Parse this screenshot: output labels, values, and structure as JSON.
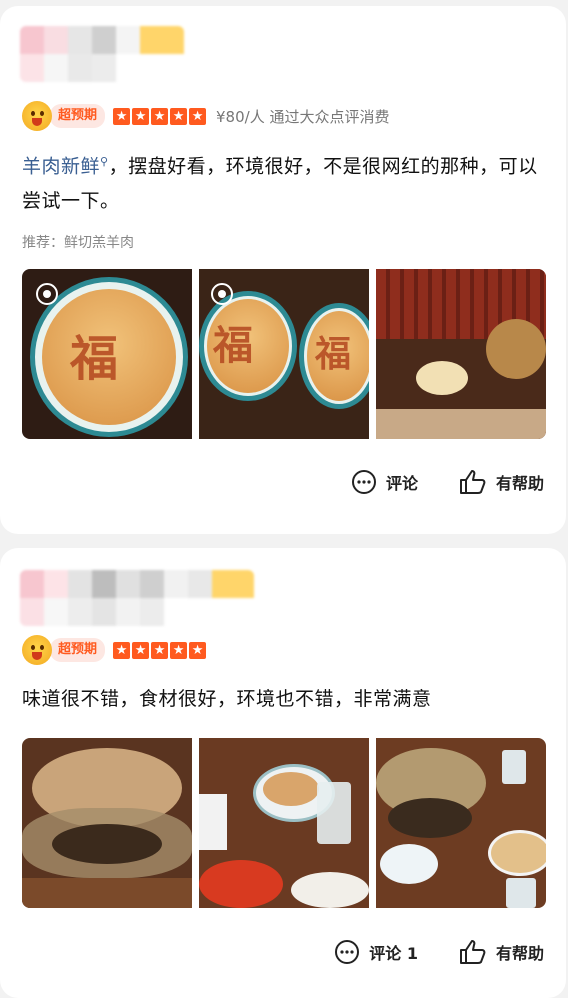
{
  "reviews": [
    {
      "badge": "超预期",
      "stars": 5,
      "star_glyph": "★",
      "price_info": "¥80/人 通过大众点评消费",
      "text_link": "羊肉新鲜",
      "text_link_icon": "search-icon",
      "text_rest": "，摆盘好看，环境很好，不是很网红的那种，可以尝试一下。",
      "recommend": "推荐：鲜切羔羊肉",
      "comment_label": "评论",
      "helpful_label": "有帮助"
    },
    {
      "badge": "超预期",
      "stars": 5,
      "star_glyph": "★",
      "text": "味道很不错，食材很好，环境也不错，非常满意",
      "comment_label": "评论 1",
      "helpful_label": "有帮助"
    }
  ],
  "photo_overlay_char": "福",
  "colors": {
    "accent": "#ff5a1f",
    "link": "#3a5f92",
    "badge_bg": "#fde7e2"
  }
}
